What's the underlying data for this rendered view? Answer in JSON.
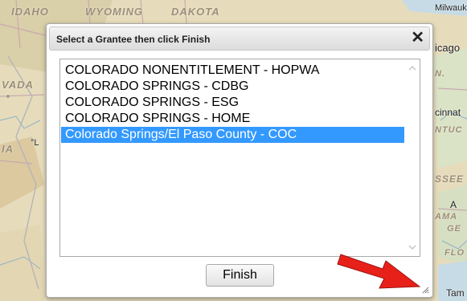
{
  "map": {
    "labels": [
      "IDAHO",
      "WYOMING",
      "DAKOTA",
      "VADA"
    ],
    "cities": [
      "Milwaukee",
      "icago",
      "Tam"
    ],
    "partials": [
      "N.",
      "cinnat",
      "NTUC",
      "SSEE",
      "IA",
      "A",
      "AMA",
      "GE",
      "FLO",
      "°",
      "°L"
    ]
  },
  "dialog": {
    "title": "Select a Grantee then click Finish",
    "close_label": "✕",
    "items": [
      {
        "label": "COLORADO NONENTITLEMENT - HOPWA",
        "selected": false
      },
      {
        "label": "COLORADO SPRINGS - CDBG",
        "selected": false
      },
      {
        "label": "COLORADO SPRINGS - ESG",
        "selected": false
      },
      {
        "label": "COLORADO SPRINGS - HOME",
        "selected": false
      },
      {
        "label": "Colorado Springs/El Paso County - COC",
        "selected": true
      }
    ],
    "finish_label": "Finish"
  },
  "colors": {
    "selection": "#3399ff",
    "arrow": "#e8201a"
  }
}
